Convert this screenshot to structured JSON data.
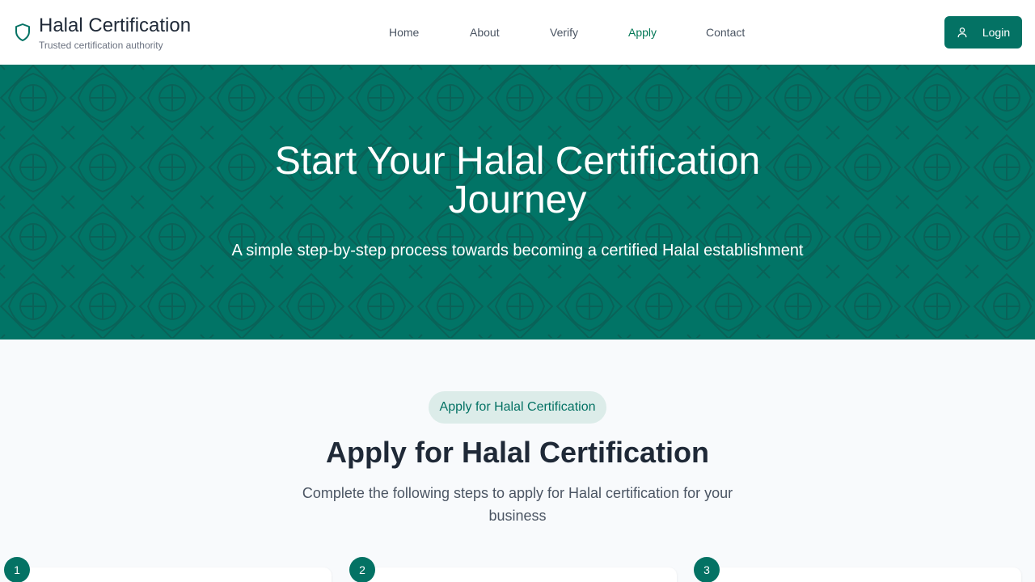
{
  "header": {
    "brand_title": "Halal Certification",
    "brand_subtitle": "Trusted certification authority",
    "brand_icon": "shield-icon",
    "nav": [
      {
        "label": "Home",
        "active": false
      },
      {
        "label": "About",
        "active": false
      },
      {
        "label": "Verify",
        "active": false
      },
      {
        "label": "Apply",
        "active": true
      },
      {
        "label": "Contact",
        "active": false
      }
    ],
    "login_label": "Login",
    "login_icon": "user-icon"
  },
  "hero": {
    "title": "Start Your Halal Certification Journey",
    "subtitle": "A simple step-by-step process towards becoming a certified Halal establishment",
    "background_color": "#017466"
  },
  "section": {
    "pill": "Apply for Halal Certification",
    "title": "Apply for Halal Certification",
    "subtitle": "Complete the following steps to apply for Halal certification for your business"
  },
  "steps": [
    {
      "number": "1"
    },
    {
      "number": "2"
    },
    {
      "number": "3"
    }
  ],
  "colors": {
    "accent": "#047264",
    "active_link": "#047857",
    "pill_bg": "#dcece9"
  }
}
